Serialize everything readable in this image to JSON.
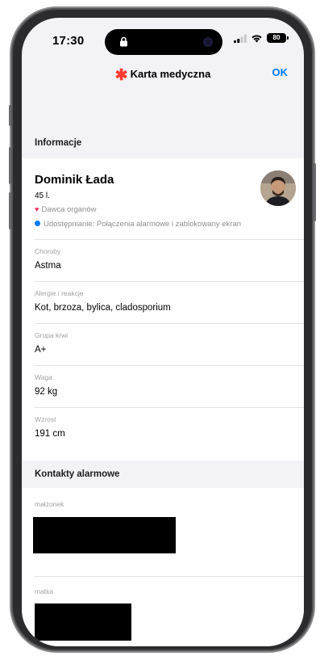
{
  "status_bar": {
    "time": "17:30",
    "battery": "80",
    "icons": [
      "lock-icon",
      "signal-icon",
      "wifi-icon",
      "battery-icon"
    ]
  },
  "nav": {
    "title": "Karta medyczna",
    "title_icon": "✱",
    "ok_label": "OK",
    "accent_color": "#007aff",
    "icon_color": "#ff3b30"
  },
  "info_section": {
    "header": "Informacje",
    "name": "Dominik Łada",
    "age": "45 l.",
    "organ_donor": "Dawca organów",
    "sharing": "Udostępnianie: Połączenia alarmowe i zablokowany ekran"
  },
  "fields": [
    {
      "label": "Choroby",
      "value": "Astma"
    },
    {
      "label": "Alergie i reakcje",
      "value": "Kot, brzoza, bylica, cladosporium"
    },
    {
      "label": "Grupa krwi",
      "value": "A+"
    },
    {
      "label": "Waga",
      "value": "92 kg"
    },
    {
      "label": "Wzrost",
      "value": "191 cm"
    }
  ],
  "contacts_section": {
    "header": "Kontakty alarmowe",
    "contacts": [
      {
        "relation": "małżonek"
      },
      {
        "relation": "matka"
      }
    ]
  }
}
